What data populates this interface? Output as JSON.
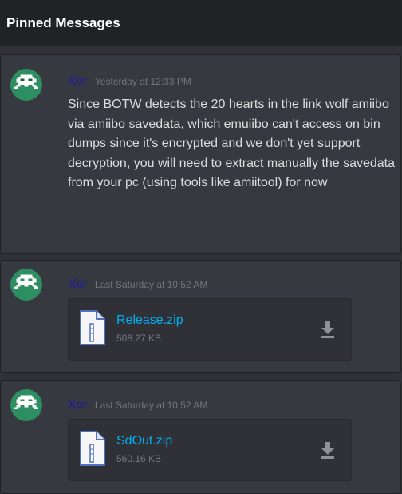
{
  "header": {
    "title": "Pinned Messages"
  },
  "messages": [
    {
      "author": "Xor",
      "timestamp": "Yesterday at 12:33 PM",
      "text": "Since BOTW detects the 20 hearts in the link wolf amiibo via amiibo savedata, which emuiibo can't access on bin dumps since it's encrypted and we don't yet support decryption, you will need to extract manually the savedata from your pc (using tools like amiitool) for now"
    },
    {
      "author": "Xor",
      "timestamp": "Last Saturday at 10:52 AM",
      "attachment": {
        "name": "Release.zip",
        "size": "508.27 KB"
      }
    },
    {
      "author": "Xor",
      "timestamp": "Last Saturday at 10:52 AM",
      "attachment": {
        "name": "SdOut.zip",
        "size": "560.16 KB"
      }
    }
  ],
  "colors": {
    "background": "#2f3136",
    "card": "#36393f",
    "header": "#202225",
    "username": "#1a1aa8",
    "link": "#00b0f4",
    "avatar": "#2d8f61"
  },
  "icons": {
    "avatar": "space-invader-icon",
    "file": "archive-file-icon",
    "download": "download-icon"
  }
}
